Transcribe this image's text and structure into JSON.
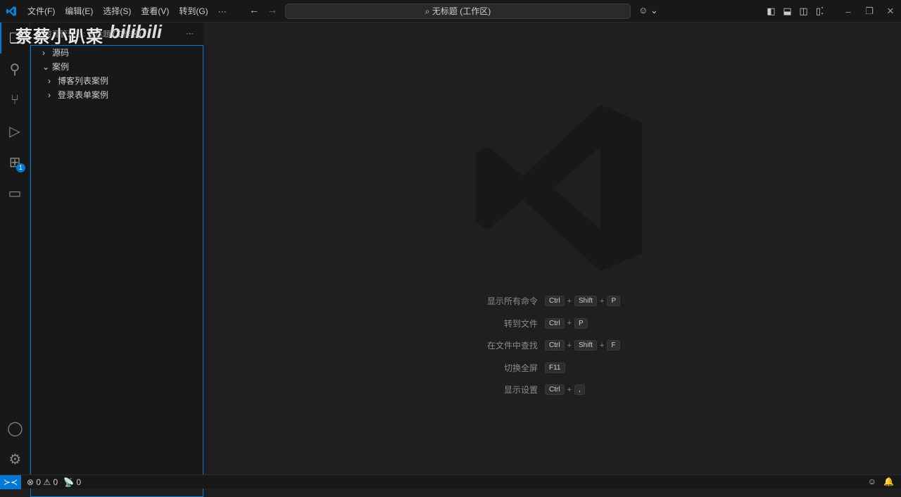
{
  "menu": [
    "文件(F)",
    "编辑(E)",
    "选择(S)",
    "查看(V)",
    "转到(G)",
    "···"
  ],
  "search": {
    "text": "无标题 (工作区)"
  },
  "sidebar": {
    "title": "资源管理器: 无标题 (工作区)",
    "more": "···",
    "tree": [
      {
        "label": "源码",
        "expanded": false,
        "level": 0
      },
      {
        "label": "案例",
        "expanded": true,
        "level": 0
      },
      {
        "label": "博客列表案例",
        "expanded": false,
        "level": 1
      },
      {
        "label": "登录表单案例",
        "expanded": false,
        "level": 1
      }
    ]
  },
  "activity": {
    "extensions_badge": "1"
  },
  "watermark": {
    "text": "蔡蔡小趴菜",
    "logo": "bilibili"
  },
  "shortcuts": [
    {
      "label": "显示所有命令",
      "keys": [
        "Ctrl",
        "Shift",
        "P"
      ]
    },
    {
      "label": "转到文件",
      "keys": [
        "Ctrl",
        "P"
      ]
    },
    {
      "label": "在文件中查找",
      "keys": [
        "Ctrl",
        "Shift",
        "F"
      ]
    },
    {
      "label": "切换全屏",
      "keys": [
        "F11"
      ]
    },
    {
      "label": "显示设置",
      "keys": [
        "Ctrl",
        ","
      ]
    }
  ],
  "status": {
    "errors": "0",
    "warnings": "0",
    "ports": "0"
  },
  "colors": {
    "accent": "#0078d4",
    "bg": "#1f1f1f",
    "panel": "#181818"
  }
}
